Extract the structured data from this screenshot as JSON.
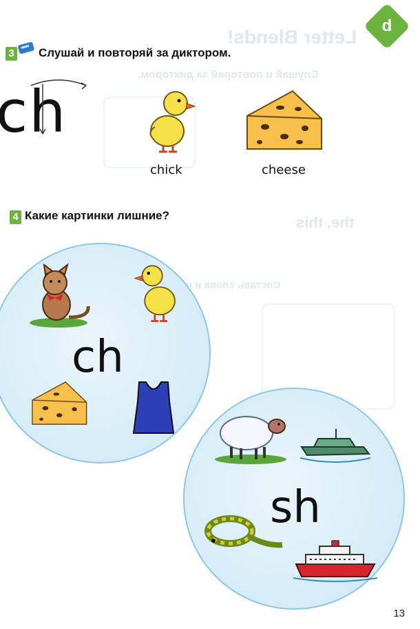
{
  "badge": {
    "letter": "d"
  },
  "exercise3": {
    "number": "3",
    "instruction": "Слушай и повторяй за диктором.",
    "letters": "ch",
    "words": [
      "chick",
      "cheese"
    ]
  },
  "exercise4": {
    "number": "4",
    "instruction": "Какие картинки лишние?",
    "circle1_letters": "ch",
    "circle2_letters": "sh"
  },
  "page_number": "13",
  "icons": {
    "audio": "cd-audio-icon",
    "chick": "chick-icon",
    "cheese": "cheese-icon",
    "cat": "cat-icon",
    "vest": "vest-icon",
    "sheep": "sheep-icon",
    "boat": "boat-icon",
    "snake": "snake-icon",
    "ship": "ship-icon"
  },
  "colors": {
    "accent_green": "#6cb33f",
    "circle_border": "#8cc8e6"
  }
}
